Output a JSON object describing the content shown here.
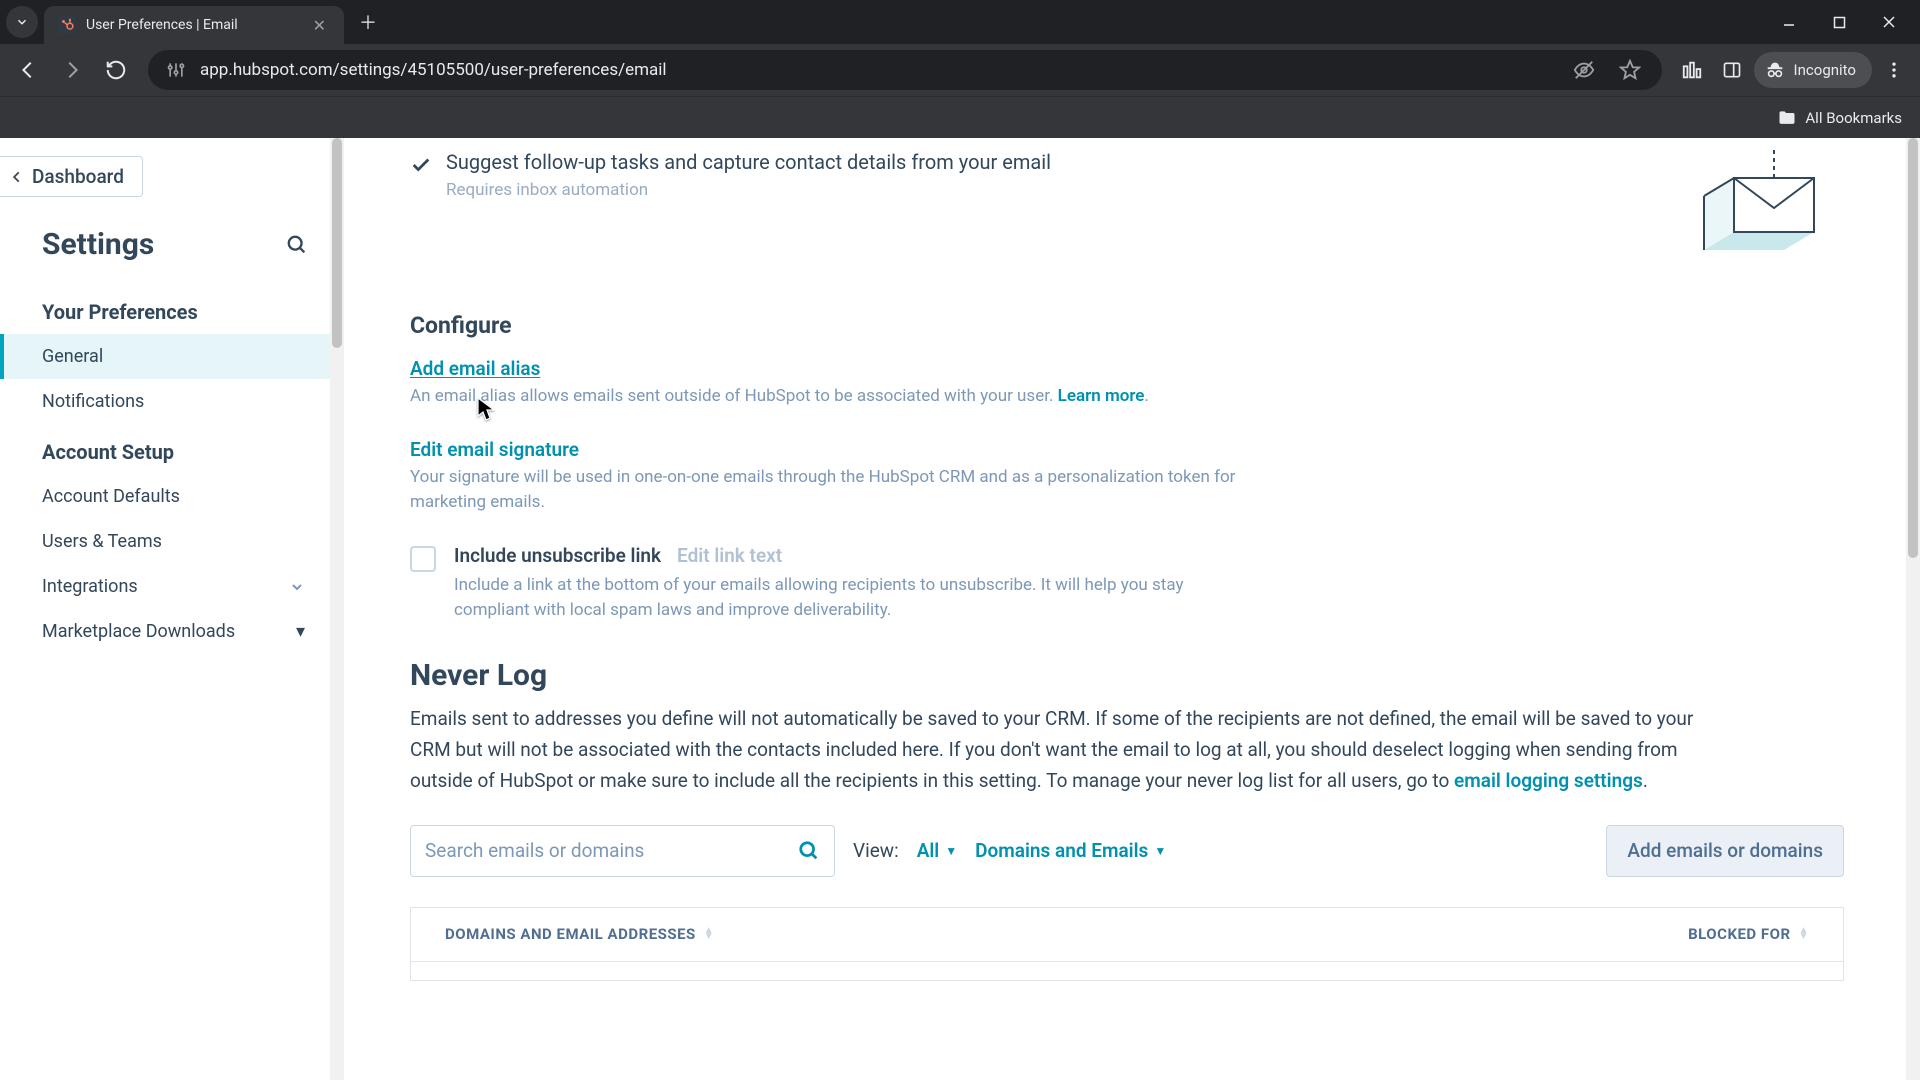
{
  "browser": {
    "tab_title": "User Preferences | Email",
    "url": "app.hubspot.com/settings/45105500/user-preferences/email",
    "incognito_label": "Incognito",
    "all_bookmarks": "All Bookmarks"
  },
  "sidebar": {
    "back_label": "Dashboard",
    "header": "Settings",
    "section_prefs": "Your Preferences",
    "items_prefs": [
      "General",
      "Notifications"
    ],
    "section_account": "Account Setup",
    "items_account": [
      "Account Defaults",
      "Users & Teams",
      "Integrations",
      "Marketplace Downloads"
    ]
  },
  "hero": {
    "line": "Suggest follow-up tasks and capture contact details from your email",
    "sub": "Requires inbox automation"
  },
  "configure": {
    "heading": "Configure",
    "alias_link": "Add email alias",
    "alias_desc": "An email alias allows emails sent outside of HubSpot to be associated with your user. ",
    "learn_more": "Learn more",
    "sig_link": "Edit email signature",
    "sig_desc": "Your signature will be used in one-on-one emails through the HubSpot CRM and as a personalization token for marketing emails.",
    "unsub_label": "Include unsubscribe link",
    "unsub_edit": "Edit link text",
    "unsub_desc": "Include a link at the bottom of your emails allowing recipients to unsubscribe. It will help you stay compliant with local spam laws and improve deliverability."
  },
  "never_log": {
    "heading": "Never Log",
    "desc_before": "Emails sent to addresses you define will not automatically be saved to your CRM. If some of the recipients are not defined, the email will be saved to your CRM but will not be associated with the contacts included here. If you don't want the email to log at all, you should deselect logging when sending from outside of HubSpot or make sure to include all the recipients in this setting. To manage your never log list for all users, go to ",
    "desc_link": "email logging settings",
    "desc_after": "."
  },
  "filters": {
    "search_placeholder": "Search emails or domains",
    "view_label": "View:",
    "view_all": "All",
    "view_scope": "Domains and Emails",
    "add_button": "Add emails or domains"
  },
  "table": {
    "col1": "Domains and Email Addresses",
    "col2": "Blocked For"
  }
}
